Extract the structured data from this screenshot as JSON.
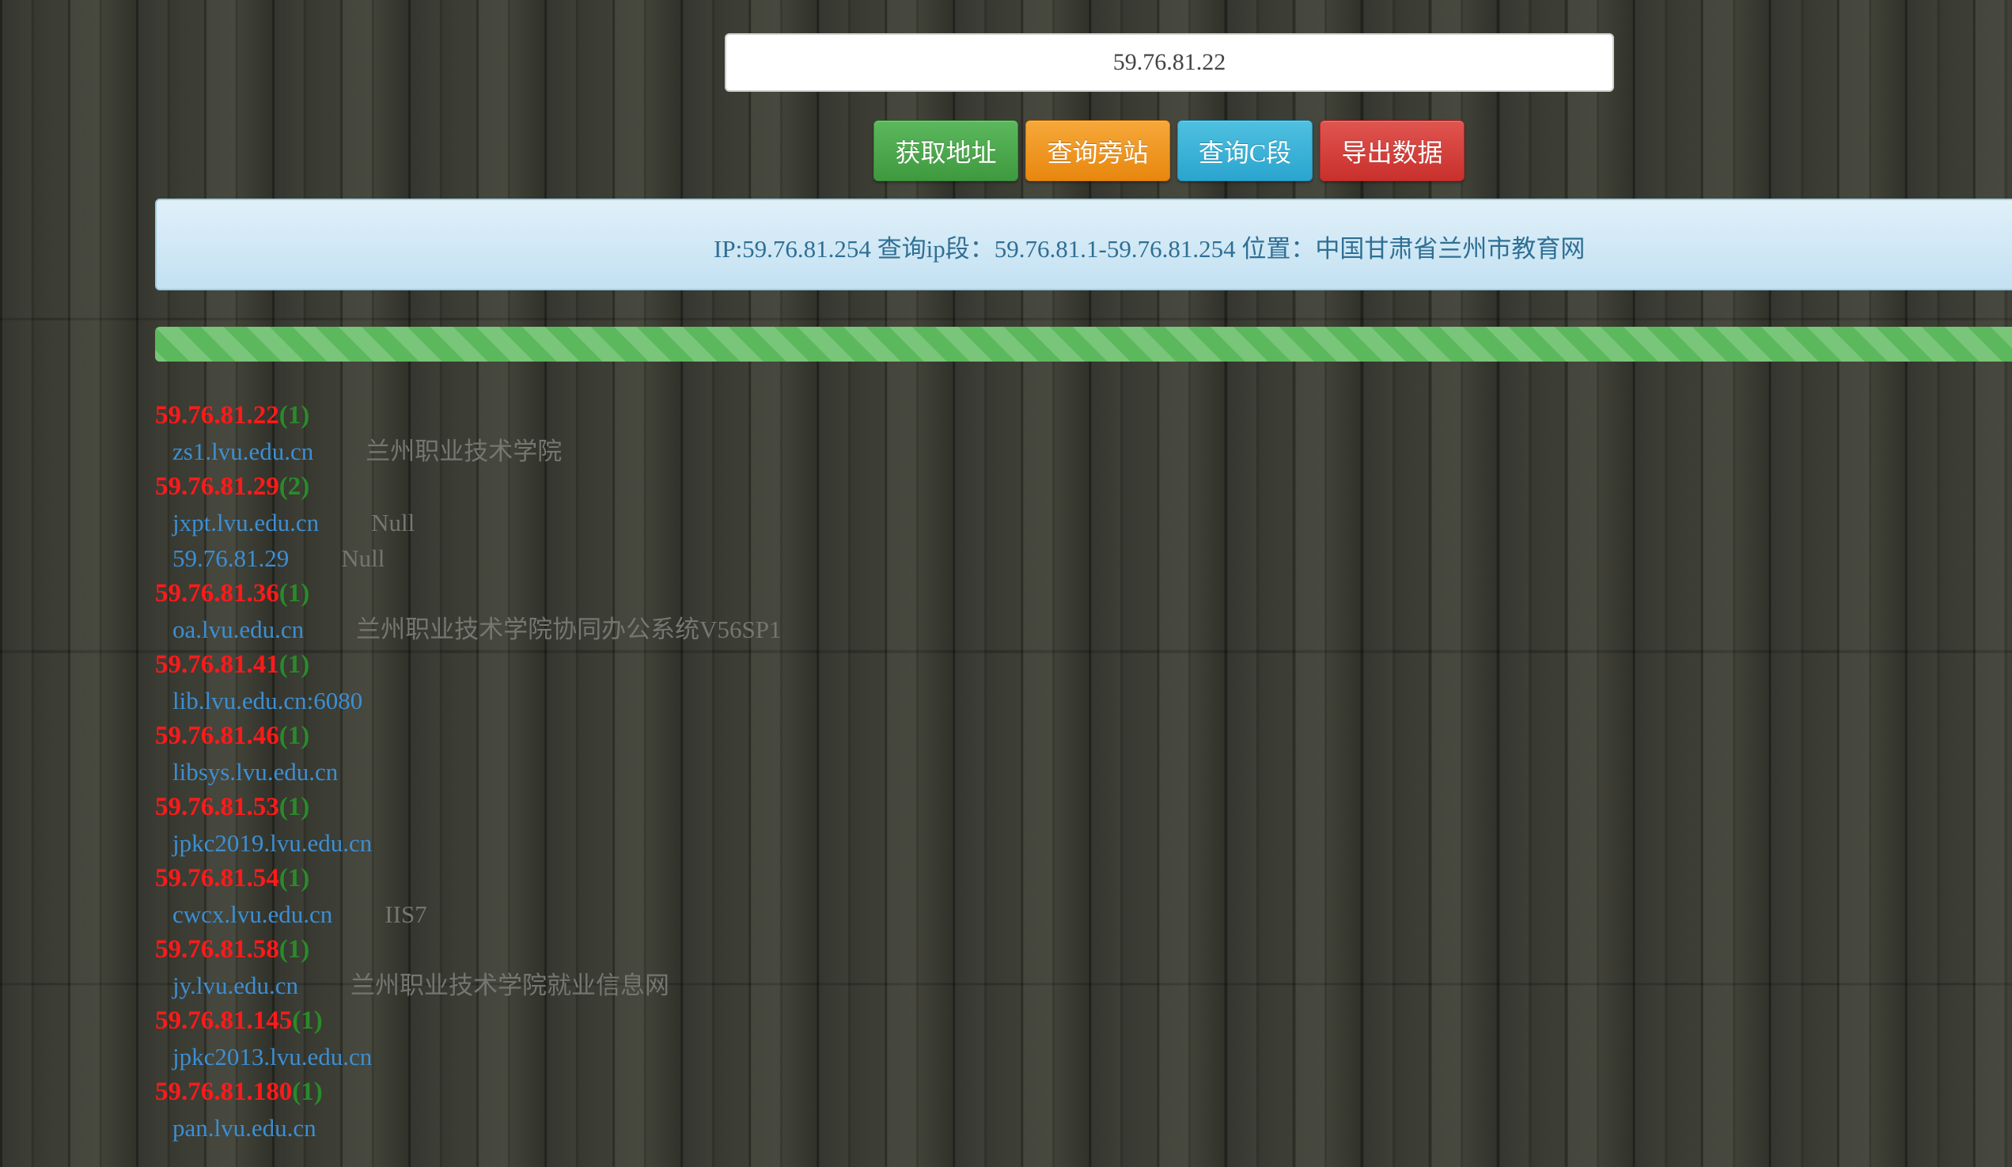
{
  "search": {
    "value": "59.76.81.22"
  },
  "buttons": {
    "get_address": "获取地址",
    "query_sites": "查询旁站",
    "query_c": "查询C段",
    "export": "导出数据"
  },
  "colors": {
    "btn_green": "#5cb85c",
    "btn_orange": "#f0ad4e",
    "btn_blue": "#39b3d7",
    "btn_red": "#d9534f",
    "ip_red": "#ff1a1a",
    "count_green": "#2a8a2a",
    "domain_blue": "#3b8fd4",
    "progress_green": "#5cb85c"
  },
  "info": {
    "text": "IP:59.76.81.254 查询ip段：59.76.81.1-59.76.81.254 位置：中国甘肃省兰州市教育网"
  },
  "progress": {
    "percent": 100
  },
  "results": [
    {
      "ip": "59.76.81.22",
      "count": "(1)",
      "sites": [
        {
          "domain": "zs1.lvu.edu.cn",
          "title": "兰州职业技术学院"
        }
      ]
    },
    {
      "ip": "59.76.81.29",
      "count": "(2)",
      "sites": [
        {
          "domain": "jxpt.lvu.edu.cn",
          "title": "Null"
        },
        {
          "domain": "59.76.81.29",
          "title": "Null"
        }
      ]
    },
    {
      "ip": "59.76.81.36",
      "count": "(1)",
      "sites": [
        {
          "domain": "oa.lvu.edu.cn",
          "title": "兰州职业技术学院协同办公系统V56SP1"
        }
      ]
    },
    {
      "ip": "59.76.81.41",
      "count": "(1)",
      "sites": [
        {
          "domain": "lib.lvu.edu.cn:6080",
          "title": ""
        }
      ]
    },
    {
      "ip": "59.76.81.46",
      "count": "(1)",
      "sites": [
        {
          "domain": "libsys.lvu.edu.cn",
          "title": ""
        }
      ]
    },
    {
      "ip": "59.76.81.53",
      "count": "(1)",
      "sites": [
        {
          "domain": "jpkc2019.lvu.edu.cn",
          "title": ""
        }
      ]
    },
    {
      "ip": "59.76.81.54",
      "count": "(1)",
      "sites": [
        {
          "domain": "cwcx.lvu.edu.cn",
          "title": "IIS7"
        }
      ]
    },
    {
      "ip": "59.76.81.58",
      "count": "(1)",
      "sites": [
        {
          "domain": "jy.lvu.edu.cn",
          "title": "兰州职业技术学院就业信息网"
        }
      ]
    },
    {
      "ip": "59.76.81.145",
      "count": "(1)",
      "sites": [
        {
          "domain": "jpkc2013.lvu.edu.cn",
          "title": ""
        }
      ]
    },
    {
      "ip": "59.76.81.180",
      "count": "(1)",
      "sites": [
        {
          "domain": "pan.lvu.edu.cn",
          "title": ""
        }
      ]
    }
  ]
}
